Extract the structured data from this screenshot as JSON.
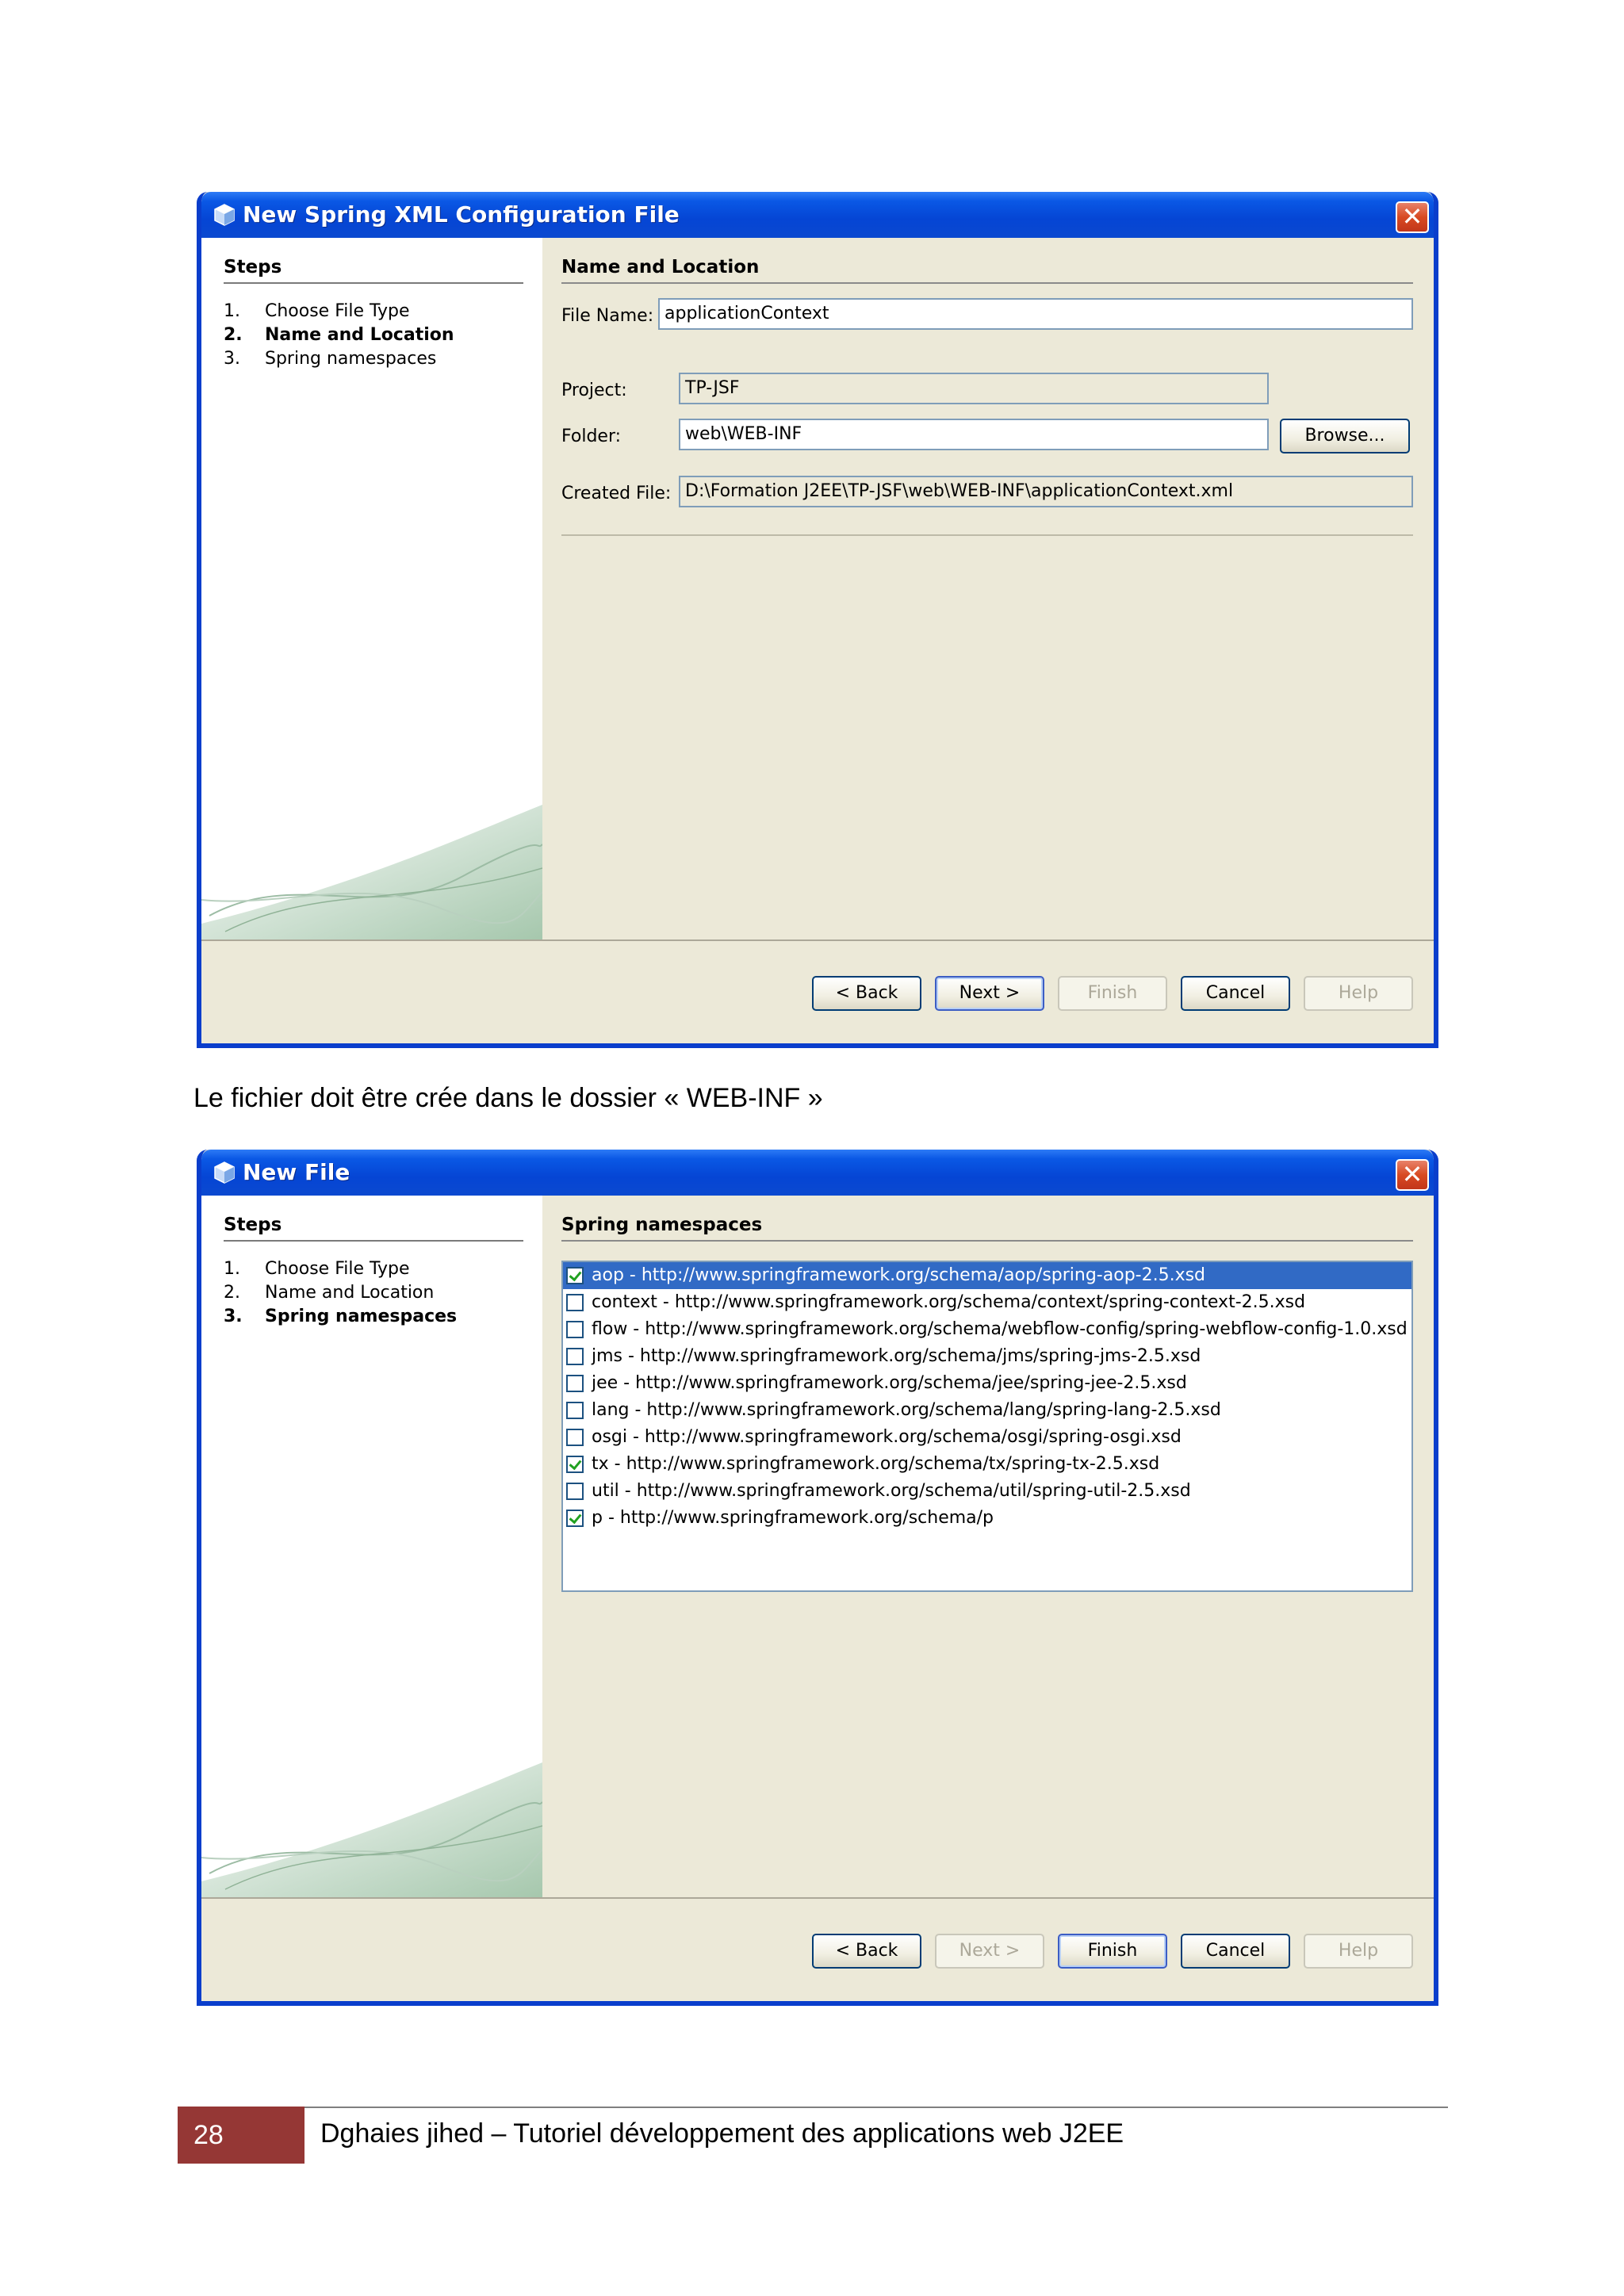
{
  "dialog1": {
    "title": "New Spring XML Configuration File",
    "close_label": "✕",
    "steps_heading": "Steps",
    "steps": [
      {
        "num": "1.",
        "label": "Choose File Type"
      },
      {
        "num": "2.",
        "label": "Name and Location"
      },
      {
        "num": "3.",
        "label": "Spring namespaces"
      }
    ],
    "section_heading": "Name and Location",
    "file_name_label": "File Name:",
    "file_name_value": "applicationContext",
    "project_label": "Project:",
    "project_value": "TP-JSF",
    "folder_label": "Folder:",
    "folder_value": "web\\WEB-INF",
    "browse_label": "Browse...",
    "created_file_label": "Created File:",
    "created_file_value": "D:\\Formation J2EE\\TP-JSF\\web\\WEB-INF\\applicationContext.xml",
    "buttons": {
      "back": "< Back",
      "next": "Next >",
      "finish": "Finish",
      "cancel": "Cancel",
      "help": "Help"
    }
  },
  "caption": "Le fichier doit être crée dans le dossier  « WEB-INF »",
  "dialog2": {
    "title": "New File",
    "close_label": "✕",
    "steps_heading": "Steps",
    "steps": [
      {
        "num": "1.",
        "label": "Choose File Type"
      },
      {
        "num": "2.",
        "label": "Name and Location"
      },
      {
        "num": "3.",
        "label": "Spring namespaces"
      }
    ],
    "section_heading": "Spring namespaces",
    "namespaces": [
      {
        "label": "aop - http://www.springframework.org/schema/aop/spring-aop-2.5.xsd",
        "checked": true
      },
      {
        "label": "context - http://www.springframework.org/schema/context/spring-context-2.5.xsd",
        "checked": false
      },
      {
        "label": "flow - http://www.springframework.org/schema/webflow-config/spring-webflow-config-1.0.xsd",
        "checked": false
      },
      {
        "label": "jms - http://www.springframework.org/schema/jms/spring-jms-2.5.xsd",
        "checked": false
      },
      {
        "label": "jee - http://www.springframework.org/schema/jee/spring-jee-2.5.xsd",
        "checked": false
      },
      {
        "label": "lang - http://www.springframework.org/schema/lang/spring-lang-2.5.xsd",
        "checked": false
      },
      {
        "label": "osgi - http://www.springframework.org/schema/osgi/spring-osgi.xsd",
        "checked": false
      },
      {
        "label": "tx - http://www.springframework.org/schema/tx/spring-tx-2.5.xsd",
        "checked": true
      },
      {
        "label": "util - http://www.springframework.org/schema/util/spring-util-2.5.xsd",
        "checked": false
      },
      {
        "label": "p - http://www.springframework.org/schema/p",
        "checked": true
      }
    ],
    "buttons": {
      "back": "< Back",
      "next": "Next >",
      "finish": "Finish",
      "cancel": "Cancel",
      "help": "Help"
    }
  },
  "footer": {
    "page_number": "28",
    "text": "Dghaies jihed – Tutoriel développement des applications web  J2EE"
  },
  "colors": {
    "titlebar": "#0a58e5",
    "selection": "#316ac5",
    "page_box": "#953735"
  }
}
